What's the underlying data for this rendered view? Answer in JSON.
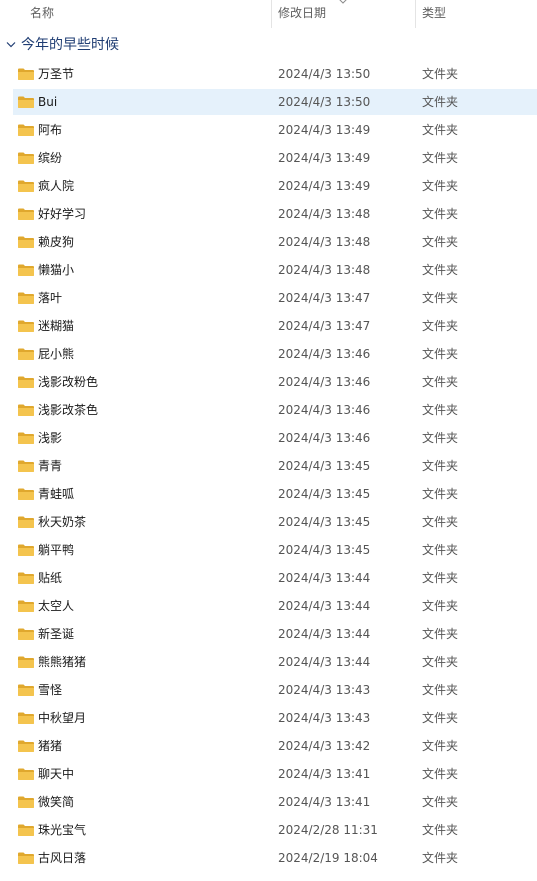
{
  "columns": {
    "name": "名称",
    "date": "修改日期",
    "type": "类型"
  },
  "sort_icon": "chevron-down-icon",
  "group": {
    "title": "今年的早些时候",
    "icon": "chevron-down-icon"
  },
  "colors": {
    "selection": "#e5f1fb",
    "folder": "#f4c44e",
    "group_title": "#1f3d73"
  },
  "files": [
    {
      "name": "万圣节",
      "date": "2024/4/3 13:50",
      "type": "文件夹",
      "selected": false
    },
    {
      "name": "Bui",
      "date": "2024/4/3 13:50",
      "type": "文件夹",
      "selected": true
    },
    {
      "name": "阿布",
      "date": "2024/4/3 13:49",
      "type": "文件夹",
      "selected": false
    },
    {
      "name": "缤纷",
      "date": "2024/4/3 13:49",
      "type": "文件夹",
      "selected": false
    },
    {
      "name": "疯人院",
      "date": "2024/4/3 13:49",
      "type": "文件夹",
      "selected": false
    },
    {
      "name": "好好学习",
      "date": "2024/4/3 13:48",
      "type": "文件夹",
      "selected": false
    },
    {
      "name": "赖皮狗",
      "date": "2024/4/3 13:48",
      "type": "文件夹",
      "selected": false
    },
    {
      "name": "懒猫小",
      "date": "2024/4/3 13:48",
      "type": "文件夹",
      "selected": false
    },
    {
      "name": "落叶",
      "date": "2024/4/3 13:47",
      "type": "文件夹",
      "selected": false
    },
    {
      "name": "迷糊猫",
      "date": "2024/4/3 13:47",
      "type": "文件夹",
      "selected": false
    },
    {
      "name": "屁小熊",
      "date": "2024/4/3 13:46",
      "type": "文件夹",
      "selected": false
    },
    {
      "name": "浅影改粉色",
      "date": "2024/4/3 13:46",
      "type": "文件夹",
      "selected": false
    },
    {
      "name": "浅影改茶色",
      "date": "2024/4/3 13:46",
      "type": "文件夹",
      "selected": false
    },
    {
      "name": "浅影",
      "date": "2024/4/3 13:46",
      "type": "文件夹",
      "selected": false
    },
    {
      "name": "青青",
      "date": "2024/4/3 13:45",
      "type": "文件夹",
      "selected": false
    },
    {
      "name": "青蛙呱",
      "date": "2024/4/3 13:45",
      "type": "文件夹",
      "selected": false
    },
    {
      "name": "秋天奶茶",
      "date": "2024/4/3 13:45",
      "type": "文件夹",
      "selected": false
    },
    {
      "name": "躺平鸭",
      "date": "2024/4/3 13:45",
      "type": "文件夹",
      "selected": false
    },
    {
      "name": "贴纸",
      "date": "2024/4/3 13:44",
      "type": "文件夹",
      "selected": false
    },
    {
      "name": "太空人",
      "date": "2024/4/3 13:44",
      "type": "文件夹",
      "selected": false
    },
    {
      "name": "新圣诞",
      "date": "2024/4/3 13:44",
      "type": "文件夹",
      "selected": false
    },
    {
      "name": "熊熊猪猪",
      "date": "2024/4/3 13:44",
      "type": "文件夹",
      "selected": false
    },
    {
      "name": "雪怪",
      "date": "2024/4/3 13:43",
      "type": "文件夹",
      "selected": false
    },
    {
      "name": "中秋望月",
      "date": "2024/4/3 13:43",
      "type": "文件夹",
      "selected": false
    },
    {
      "name": "猪猪",
      "date": "2024/4/3 13:42",
      "type": "文件夹",
      "selected": false
    },
    {
      "name": "聊天中",
      "date": "2024/4/3 13:41",
      "type": "文件夹",
      "selected": false
    },
    {
      "name": "微笑简",
      "date": "2024/4/3 13:41",
      "type": "文件夹",
      "selected": false
    },
    {
      "name": "珠光宝气",
      "date": "2024/2/28 11:31",
      "type": "文件夹",
      "selected": false
    },
    {
      "name": "古风日落",
      "date": "2024/2/19 18:04",
      "type": "文件夹",
      "selected": false
    }
  ]
}
